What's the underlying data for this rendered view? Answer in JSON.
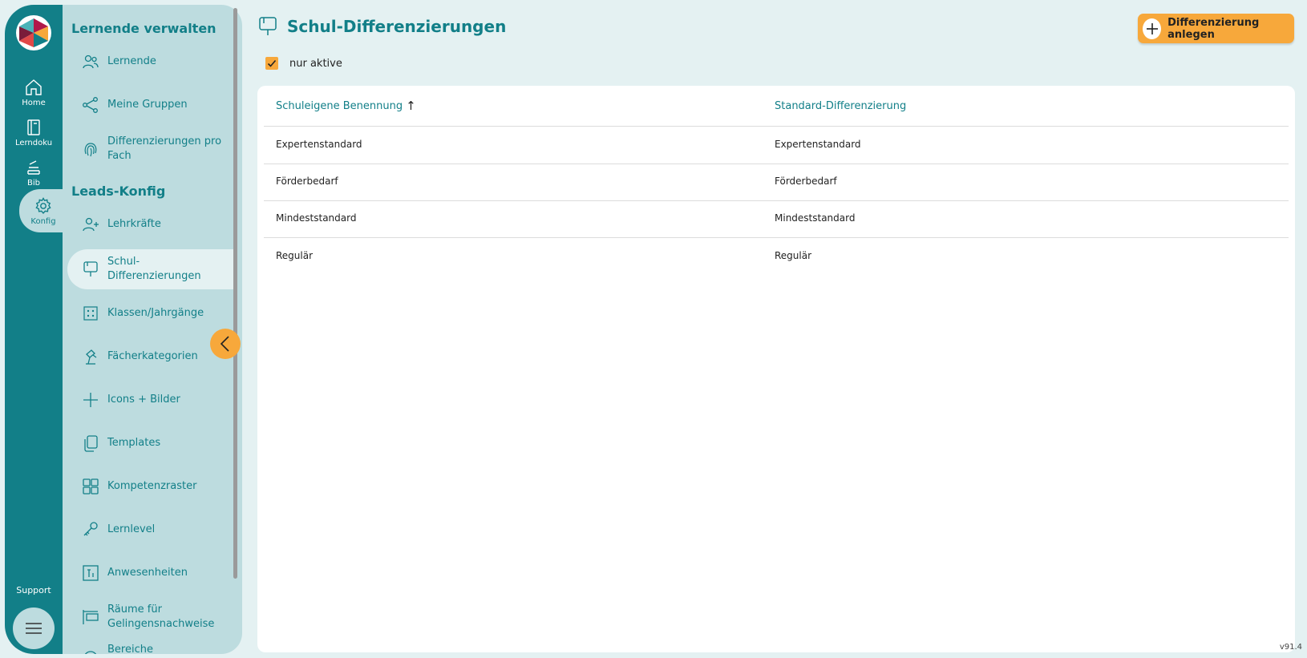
{
  "rail": {
    "items": [
      {
        "label": "Home",
        "icon": "home-icon"
      },
      {
        "label": "Lerndoku",
        "icon": "notebook-icon"
      },
      {
        "label": "Bib",
        "icon": "books-icon"
      },
      {
        "label": "Konfig",
        "icon": "gear-icon"
      }
    ],
    "support_label": "Support",
    "menu_icon": "hamburger-icon"
  },
  "sidebar": {
    "section1_title": "Lernende verwalten",
    "section2_title": "Leads-Konfig",
    "items": [
      {
        "label": "Lernende",
        "icon": "users-icon"
      },
      {
        "label": "Meine Gruppen",
        "icon": "share-nodes-icon"
      },
      {
        "label": "Differenzierungen pro Fach",
        "icon": "fingerprint-icon"
      },
      {
        "label": "Lehrkräfte",
        "icon": "user-plus-icon"
      },
      {
        "label": "Schul-Differenzierungen",
        "icon": "easel-icon"
      },
      {
        "label": "Klassen/Jahrgänge",
        "icon": "grid-dots-icon"
      },
      {
        "label": "Fächerkategorien",
        "icon": "lamp-icon"
      },
      {
        "label": "Icons + Bilder",
        "icon": "plus-icon"
      },
      {
        "label": "Templates",
        "icon": "copy-icon"
      },
      {
        "label": "Kompetenzraster",
        "icon": "tiles-icon"
      },
      {
        "label": "Lernlevel",
        "icon": "key-icon"
      },
      {
        "label": "Anwesenheiten",
        "icon": "attendance-icon"
      },
      {
        "label": "Räume für Gelingensnachweise",
        "icon": "room-sign-icon"
      },
      {
        "label": "Bereiche",
        "icon": "area-icon"
      }
    ],
    "active_item": "Schul-Differenzierungen"
  },
  "main": {
    "title": "Schul-Differenzierungen",
    "add_button_label": "Differenzierung anlegen",
    "filter_label": "nur aktive",
    "filter_checked": true,
    "columns": [
      "Schuleigene Benennung",
      "Standard-Differenzierung"
    ],
    "sort_indicator": "↑",
    "rows": [
      [
        "Expertenstandard",
        "Expertenstandard"
      ],
      [
        "Förderbedarf",
        "Förderbedarf"
      ],
      [
        "Mindeststandard",
        "Mindeststandard"
      ],
      [
        "Regulär",
        "Regulär"
      ]
    ]
  },
  "version": "v91.4",
  "colors": {
    "teal": "#127f88",
    "sidebar_bg": "#bddcdf",
    "page_bg": "#e4f1f2",
    "accent_orange": "#f7a83b"
  }
}
